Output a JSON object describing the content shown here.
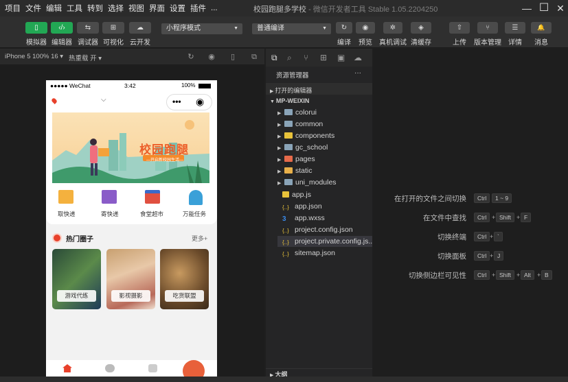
{
  "menu": [
    "项目",
    "文件",
    "编辑",
    "工具",
    "转到",
    "选择",
    "视图",
    "界面",
    "设置",
    "插件",
    "..."
  ],
  "window_title": {
    "main": "校园跑腿多学校",
    "sub": "- 微信开发者工具 Stable 1.05.2204250"
  },
  "window_controls": {
    "minimize": "—",
    "maximize": "☐",
    "close": "✕"
  },
  "toolbar": {
    "left_buttons": [
      {
        "label": "模拟器",
        "icon": "▯"
      },
      {
        "label": "编辑器",
        "icon": "‹/›"
      },
      {
        "label": "调试器",
        "icon": "⇆"
      },
      {
        "label": "可视化",
        "icon": "⊞"
      },
      {
        "label": "云开发",
        "icon": "☁"
      }
    ],
    "mode_select": "小程序模式",
    "compile_select": "普通编译",
    "mid_buttons": [
      {
        "label": "编译",
        "icon": "↻"
      },
      {
        "label": "预览",
        "icon": "◉"
      },
      {
        "label": "真机调试",
        "icon": "✲"
      },
      {
        "label": "清缓存",
        "icon": "◈"
      }
    ],
    "right_buttons": [
      {
        "label": "上传",
        "icon": "⇧"
      },
      {
        "label": "版本管理",
        "icon": "⑂"
      },
      {
        "label": "详情",
        "icon": "☰"
      },
      {
        "label": "消息",
        "icon": "🔔"
      }
    ]
  },
  "simulator": {
    "device": "iPhone 5 100% 16 ▾",
    "hot_reload": "热重载 开 ▾"
  },
  "phone": {
    "status": {
      "carrier": "●●●●● WeChat",
      "time": "3:42",
      "battery": "100%"
    },
    "capsule": {
      "dots": "•••",
      "target": "◉"
    },
    "banner": {
      "title": "校园跑腿",
      "subtitle": "—开启新校园生活—"
    },
    "services": [
      {
        "label": "取快递",
        "color": "#e8a03a"
      },
      {
        "label": "寄快递",
        "color": "#8a5cc8"
      },
      {
        "label": "食堂超市",
        "color": "#e05040"
      },
      {
        "label": "万能任务",
        "color": "#3aa0d8"
      }
    ],
    "hot": {
      "title": "热门圈子",
      "more": "更多+"
    },
    "cards": [
      {
        "label": "游戏代练"
      },
      {
        "label": "影视摄影"
      },
      {
        "label": "吃货联盟"
      }
    ]
  },
  "explorer": {
    "title": "资源管理器",
    "more": "···",
    "open_editors": "打开的编辑器",
    "root": "MP-WEIXIN",
    "folders": [
      {
        "name": "colorui",
        "color": "#8aa4b8"
      },
      {
        "name": "common",
        "color": "#8aa4b8"
      },
      {
        "name": "components",
        "color": "#e8c23a"
      },
      {
        "name": "gc_school",
        "color": "#8aa4b8"
      },
      {
        "name": "pages",
        "color": "#e66a4a"
      },
      {
        "name": "static",
        "color": "#e8b04a"
      },
      {
        "name": "uni_modules",
        "color": "#8aa4b8"
      }
    ],
    "files": [
      {
        "name": "app.js",
        "icon": "JS",
        "color": "#e8c23a"
      },
      {
        "name": "app.json",
        "icon": "{..}",
        "color": "#e8c23a"
      },
      {
        "name": "app.wxss",
        "icon": "3",
        "color": "#3a8ae8"
      },
      {
        "name": "project.config.json",
        "icon": "{..}",
        "color": "#e8c23a"
      },
      {
        "name": "project.private.config.js...",
        "icon": "{..}",
        "color": "#e8c23a"
      },
      {
        "name": "sitemap.json",
        "icon": "{..}",
        "color": "#e8c23a"
      }
    ],
    "outline": "大纲"
  },
  "shortcuts": [
    {
      "label": "在打开的文件之间切换",
      "keys": [
        "Ctrl",
        "1 ~ 9"
      ]
    },
    {
      "label": "在文件中查找",
      "keys": [
        "Ctrl",
        "Shift",
        "F"
      ]
    },
    {
      "label": "切换终端",
      "keys": [
        "Ctrl",
        "`"
      ]
    },
    {
      "label": "切换面板",
      "keys": [
        "Ctrl",
        "J"
      ]
    },
    {
      "label": "切换侧边栏可见性",
      "keys": [
        "Ctrl",
        "Shift",
        "Alt",
        "B"
      ]
    }
  ],
  "colors": {
    "accent": "#22a754",
    "banner_orange": "#f0a040",
    "bg_dark": "#1e1e1e"
  }
}
